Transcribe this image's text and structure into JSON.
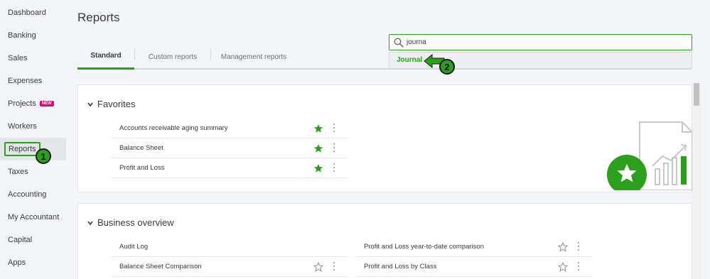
{
  "sidebar": {
    "items": [
      {
        "label": "Dashboard"
      },
      {
        "label": "Banking"
      },
      {
        "label": "Sales"
      },
      {
        "label": "Expenses"
      },
      {
        "label": "Projects",
        "badge": "NEW"
      },
      {
        "label": "Workers"
      },
      {
        "label": "Reports"
      },
      {
        "label": "Taxes"
      },
      {
        "label": "Accounting"
      },
      {
        "label": "My Accountant"
      },
      {
        "label": "Capital"
      },
      {
        "label": "Apps"
      }
    ]
  },
  "callouts": {
    "one": "1",
    "two": "2"
  },
  "page": {
    "title": "Reports"
  },
  "tabs": [
    {
      "label": "Standard"
    },
    {
      "label": "Custom reports"
    },
    {
      "label": "Management reports"
    }
  ],
  "search": {
    "value": "journa",
    "suggestion": "Journal"
  },
  "favorites": {
    "title": "Favorites",
    "items": [
      {
        "label": "Accounts receivable aging summary",
        "favorited": true
      },
      {
        "label": "Balance Sheet",
        "favorited": true
      },
      {
        "label": "Profit and Loss",
        "favorited": true
      }
    ]
  },
  "business_overview": {
    "title": "Business overview",
    "left": [
      {
        "label": "Audit Log"
      },
      {
        "label": "Balance Sheet Comparison",
        "favorited": false
      }
    ],
    "right": [
      {
        "label": "Profit and Loss year-to-date comparison",
        "favorited": false
      },
      {
        "label": "Profit and Loss by Class",
        "favorited": false
      }
    ]
  },
  "colors": {
    "accent": "#2ca01c",
    "badge": "#e4007c"
  }
}
